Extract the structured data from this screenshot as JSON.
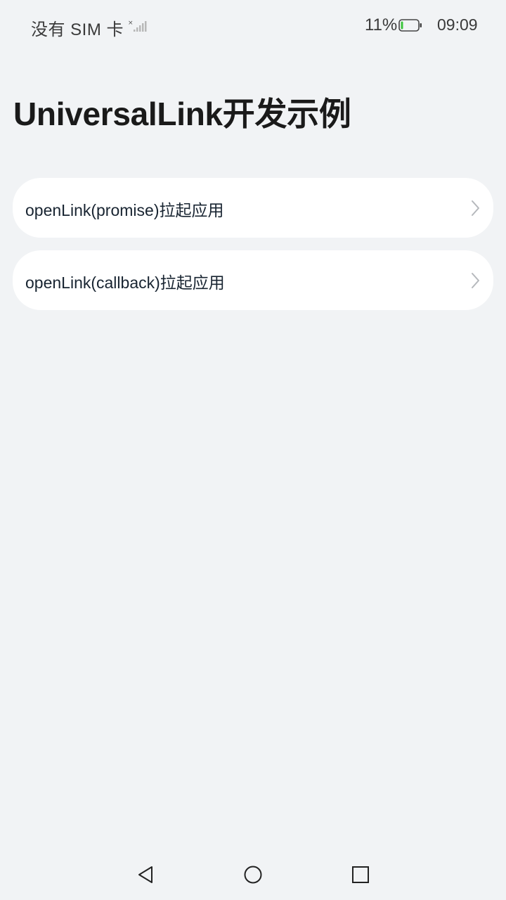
{
  "status_bar": {
    "carrier": "没有 SIM 卡",
    "battery_percent": "11%",
    "battery_level": 0.11,
    "time": "09:09"
  },
  "page": {
    "title": "UniversalLink开发示例"
  },
  "list": {
    "items": [
      {
        "label": "openLink(promise)拉起应用"
      },
      {
        "label": "openLink(callback)拉起应用"
      }
    ]
  },
  "nav_bar": {
    "icons": [
      "back-icon",
      "home-icon",
      "recent-apps-icon"
    ]
  },
  "colors": {
    "background": "#f1f3f5",
    "card": "#ffffff",
    "text_primary": "#182431",
    "battery_low": "#3cc43c"
  }
}
